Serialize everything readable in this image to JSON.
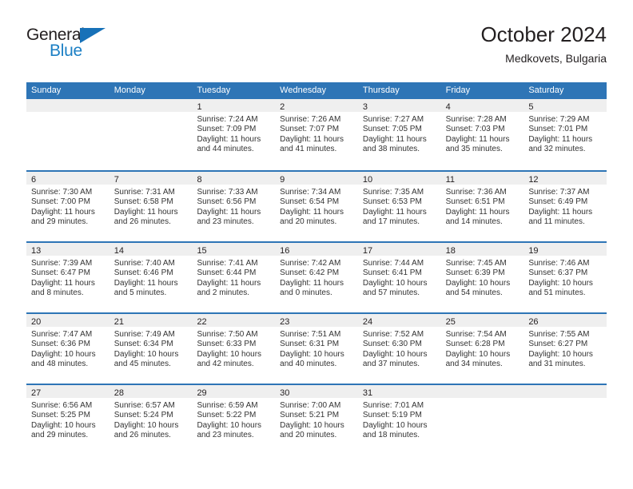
{
  "brand": {
    "name_part1": "General",
    "name_part2": "Blue",
    "logo_icon": "triangle-flag-icon",
    "accent_color": "#1771b8"
  },
  "header": {
    "title": "October 2024",
    "subtitle": "Medkovets, Bulgaria"
  },
  "colors": {
    "header_blue": "#2e75b6",
    "daynum_band": "#efefef",
    "text": "#231f20"
  },
  "calendar": {
    "weekday_headers": [
      "Sunday",
      "Monday",
      "Tuesday",
      "Wednesday",
      "Thursday",
      "Friday",
      "Saturday"
    ],
    "weeks": [
      [
        {
          "day": "",
          "empty": true,
          "lines": []
        },
        {
          "day": "",
          "empty": true,
          "lines": []
        },
        {
          "day": "1",
          "empty": false,
          "lines": [
            "Sunrise: 7:24 AM",
            "Sunset: 7:09 PM",
            "Daylight: 11 hours",
            "and 44 minutes."
          ]
        },
        {
          "day": "2",
          "empty": false,
          "lines": [
            "Sunrise: 7:26 AM",
            "Sunset: 7:07 PM",
            "Daylight: 11 hours",
            "and 41 minutes."
          ]
        },
        {
          "day": "3",
          "empty": false,
          "lines": [
            "Sunrise: 7:27 AM",
            "Sunset: 7:05 PM",
            "Daylight: 11 hours",
            "and 38 minutes."
          ]
        },
        {
          "day": "4",
          "empty": false,
          "lines": [
            "Sunrise: 7:28 AM",
            "Sunset: 7:03 PM",
            "Daylight: 11 hours",
            "and 35 minutes."
          ]
        },
        {
          "day": "5",
          "empty": false,
          "lines": [
            "Sunrise: 7:29 AM",
            "Sunset: 7:01 PM",
            "Daylight: 11 hours",
            "and 32 minutes."
          ]
        }
      ],
      [
        {
          "day": "6",
          "empty": false,
          "lines": [
            "Sunrise: 7:30 AM",
            "Sunset: 7:00 PM",
            "Daylight: 11 hours",
            "and 29 minutes."
          ]
        },
        {
          "day": "7",
          "empty": false,
          "lines": [
            "Sunrise: 7:31 AM",
            "Sunset: 6:58 PM",
            "Daylight: 11 hours",
            "and 26 minutes."
          ]
        },
        {
          "day": "8",
          "empty": false,
          "lines": [
            "Sunrise: 7:33 AM",
            "Sunset: 6:56 PM",
            "Daylight: 11 hours",
            "and 23 minutes."
          ]
        },
        {
          "day": "9",
          "empty": false,
          "lines": [
            "Sunrise: 7:34 AM",
            "Sunset: 6:54 PM",
            "Daylight: 11 hours",
            "and 20 minutes."
          ]
        },
        {
          "day": "10",
          "empty": false,
          "lines": [
            "Sunrise: 7:35 AM",
            "Sunset: 6:53 PM",
            "Daylight: 11 hours",
            "and 17 minutes."
          ]
        },
        {
          "day": "11",
          "empty": false,
          "lines": [
            "Sunrise: 7:36 AM",
            "Sunset: 6:51 PM",
            "Daylight: 11 hours",
            "and 14 minutes."
          ]
        },
        {
          "day": "12",
          "empty": false,
          "lines": [
            "Sunrise: 7:37 AM",
            "Sunset: 6:49 PM",
            "Daylight: 11 hours",
            "and 11 minutes."
          ]
        }
      ],
      [
        {
          "day": "13",
          "empty": false,
          "lines": [
            "Sunrise: 7:39 AM",
            "Sunset: 6:47 PM",
            "Daylight: 11 hours",
            "and 8 minutes."
          ]
        },
        {
          "day": "14",
          "empty": false,
          "lines": [
            "Sunrise: 7:40 AM",
            "Sunset: 6:46 PM",
            "Daylight: 11 hours",
            "and 5 minutes."
          ]
        },
        {
          "day": "15",
          "empty": false,
          "lines": [
            "Sunrise: 7:41 AM",
            "Sunset: 6:44 PM",
            "Daylight: 11 hours",
            "and 2 minutes."
          ]
        },
        {
          "day": "16",
          "empty": false,
          "lines": [
            "Sunrise: 7:42 AM",
            "Sunset: 6:42 PM",
            "Daylight: 11 hours",
            "and 0 minutes."
          ]
        },
        {
          "day": "17",
          "empty": false,
          "lines": [
            "Sunrise: 7:44 AM",
            "Sunset: 6:41 PM",
            "Daylight: 10 hours",
            "and 57 minutes."
          ]
        },
        {
          "day": "18",
          "empty": false,
          "lines": [
            "Sunrise: 7:45 AM",
            "Sunset: 6:39 PM",
            "Daylight: 10 hours",
            "and 54 minutes."
          ]
        },
        {
          "day": "19",
          "empty": false,
          "lines": [
            "Sunrise: 7:46 AM",
            "Sunset: 6:37 PM",
            "Daylight: 10 hours",
            "and 51 minutes."
          ]
        }
      ],
      [
        {
          "day": "20",
          "empty": false,
          "lines": [
            "Sunrise: 7:47 AM",
            "Sunset: 6:36 PM",
            "Daylight: 10 hours",
            "and 48 minutes."
          ]
        },
        {
          "day": "21",
          "empty": false,
          "lines": [
            "Sunrise: 7:49 AM",
            "Sunset: 6:34 PM",
            "Daylight: 10 hours",
            "and 45 minutes."
          ]
        },
        {
          "day": "22",
          "empty": false,
          "lines": [
            "Sunrise: 7:50 AM",
            "Sunset: 6:33 PM",
            "Daylight: 10 hours",
            "and 42 minutes."
          ]
        },
        {
          "day": "23",
          "empty": false,
          "lines": [
            "Sunrise: 7:51 AM",
            "Sunset: 6:31 PM",
            "Daylight: 10 hours",
            "and 40 minutes."
          ]
        },
        {
          "day": "24",
          "empty": false,
          "lines": [
            "Sunrise: 7:52 AM",
            "Sunset: 6:30 PM",
            "Daylight: 10 hours",
            "and 37 minutes."
          ]
        },
        {
          "day": "25",
          "empty": false,
          "lines": [
            "Sunrise: 7:54 AM",
            "Sunset: 6:28 PM",
            "Daylight: 10 hours",
            "and 34 minutes."
          ]
        },
        {
          "day": "26",
          "empty": false,
          "lines": [
            "Sunrise: 7:55 AM",
            "Sunset: 6:27 PM",
            "Daylight: 10 hours",
            "and 31 minutes."
          ]
        }
      ],
      [
        {
          "day": "27",
          "empty": false,
          "lines": [
            "Sunrise: 6:56 AM",
            "Sunset: 5:25 PM",
            "Daylight: 10 hours",
            "and 29 minutes."
          ]
        },
        {
          "day": "28",
          "empty": false,
          "lines": [
            "Sunrise: 6:57 AM",
            "Sunset: 5:24 PM",
            "Daylight: 10 hours",
            "and 26 minutes."
          ]
        },
        {
          "day": "29",
          "empty": false,
          "lines": [
            "Sunrise: 6:59 AM",
            "Sunset: 5:22 PM",
            "Daylight: 10 hours",
            "and 23 minutes."
          ]
        },
        {
          "day": "30",
          "empty": false,
          "lines": [
            "Sunrise: 7:00 AM",
            "Sunset: 5:21 PM",
            "Daylight: 10 hours",
            "and 20 minutes."
          ]
        },
        {
          "day": "31",
          "empty": false,
          "lines": [
            "Sunrise: 7:01 AM",
            "Sunset: 5:19 PM",
            "Daylight: 10 hours",
            "and 18 minutes."
          ]
        },
        {
          "day": "",
          "empty": true,
          "lines": []
        },
        {
          "day": "",
          "empty": true,
          "lines": []
        }
      ]
    ]
  }
}
